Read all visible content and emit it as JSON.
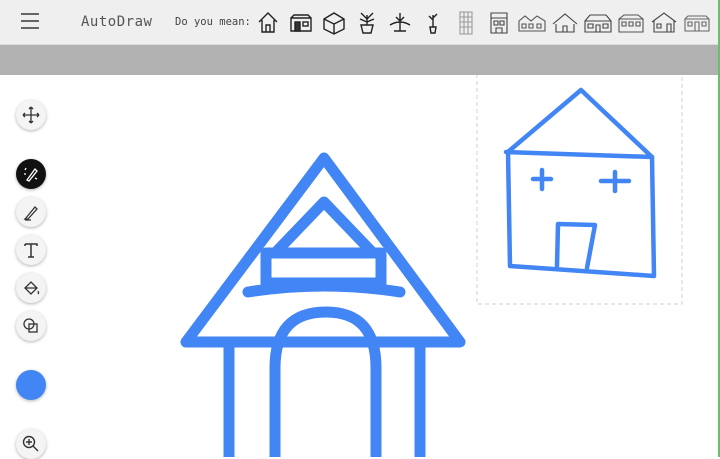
{
  "app": {
    "title": "AutoDraw"
  },
  "suggestions": {
    "label": "Do you mean:",
    "items": [
      "doghouse-icon",
      "house-front-icon",
      "cube-house-icon",
      "potted-plant-icon",
      "lamp-icon",
      "small-plant-icon",
      "tall-building-icon",
      "townhouse-icon",
      "row-houses-icon",
      "hut-icon",
      "cabin-icon",
      "mansion-icon",
      "cottage-icon",
      "barn-icon"
    ]
  },
  "tools": [
    "select-move-icon",
    "autodraw-icon",
    "draw-pencil-icon",
    "text-type-icon",
    "fill-bucket-icon",
    "shape-icon",
    "zoom-in-icon"
  ],
  "colors": {
    "active_color": "#4285f4",
    "stroke": "#4285f4"
  }
}
